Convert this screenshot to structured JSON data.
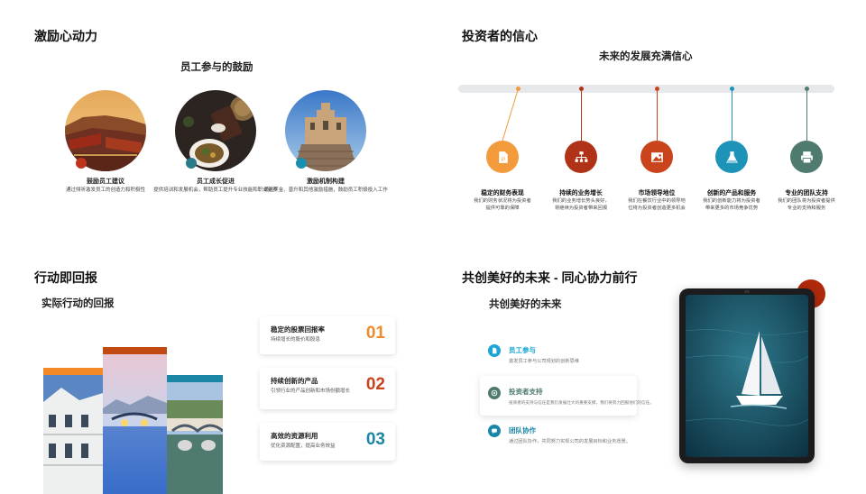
{
  "incentive": {
    "title": "激励心动力",
    "subtitle": "员工参与的鼓励",
    "items": [
      {
        "title": "鼓励员工建议",
        "desc": "通过倾听激发员工的创造力和积极性"
      },
      {
        "title": "员工成长促进",
        "desc": "提供培训和发展机会，帮助员工提升专业技能和职业素养"
      },
      {
        "title": "激励机制构建",
        "desc": "通过奖金、晋升和其他激励措施，鼓励员工积极投入工作"
      }
    ],
    "colors": {
      "dot1": "#c0341d",
      "dot2": "#2a7a8a",
      "dot3": "#1a8fb0"
    }
  },
  "investor": {
    "title": "投资者的信心",
    "subtitle": "未来的发展充满信心",
    "milestones": [
      {
        "title": "稳定的财务表现",
        "desc": "我们的财务状况将为投资者提供可靠的保障",
        "color": "#f39a3b",
        "icon": "document-icon"
      },
      {
        "title": "持续的业务增长",
        "desc": "我们的业务增长势头良好，将继续为投资者带来回报",
        "color": "#b03318",
        "icon": "org-chart-icon"
      },
      {
        "title": "市场领导地位",
        "desc": "我们在餐饮行业中的领导地位将为投资者创造更多机会",
        "color": "#c9431c",
        "icon": "image-icon"
      },
      {
        "title": "创新的产品和服务",
        "desc": "我们的创新能力将为投资者带来更多的市场竞争优势",
        "color": "#1e93b8",
        "icon": "flask-icon"
      },
      {
        "title": "专业的团队支持",
        "desc": "我们的团队将为投资者提供专业的支持和服务",
        "color": "#4f7a70",
        "icon": "printer-icon"
      }
    ]
  },
  "action": {
    "title": "行动即回报",
    "subtitle": "实际行动的回报",
    "cards": [
      {
        "title": "稳定的股票回报率",
        "desc": "持续增长的股价和股息",
        "number": "01",
        "color": "#f08a2a"
      },
      {
        "title": "持续创新的产品",
        "desc": "引领行业的产品创新和市场份额增长",
        "number": "02",
        "color": "#c9431c"
      },
      {
        "title": "高效的资源利用",
        "desc": "优化资源配置，提高业务效益",
        "number": "03",
        "color": "#1a86a8"
      }
    ],
    "bar_colors": [
      "#f28a26",
      "#c04a12",
      "#1a86a8"
    ]
  },
  "future": {
    "title": "共创美好的未来 - 同心协力前行",
    "subtitle": "共创美好的未来",
    "items": [
      {
        "title": "员工参与",
        "desc": "激发员工参与公司规划的创新思维",
        "color": "#1aa7d6",
        "icon": "document-icon"
      },
      {
        "title": "投资者支持",
        "desc": "投资者的支持与信任是我们发展壮大的重要支撑，我们将努力回报他们的信任。",
        "color": "#4f7a70",
        "icon": "target-icon"
      },
      {
        "title": "团队协作",
        "desc": "通过团队协作，共同努力实现公司的发展目标和业务愿景。",
        "color": "#1a86a8",
        "icon": "chat-icon"
      }
    ],
    "accent": "#b02a0c"
  }
}
